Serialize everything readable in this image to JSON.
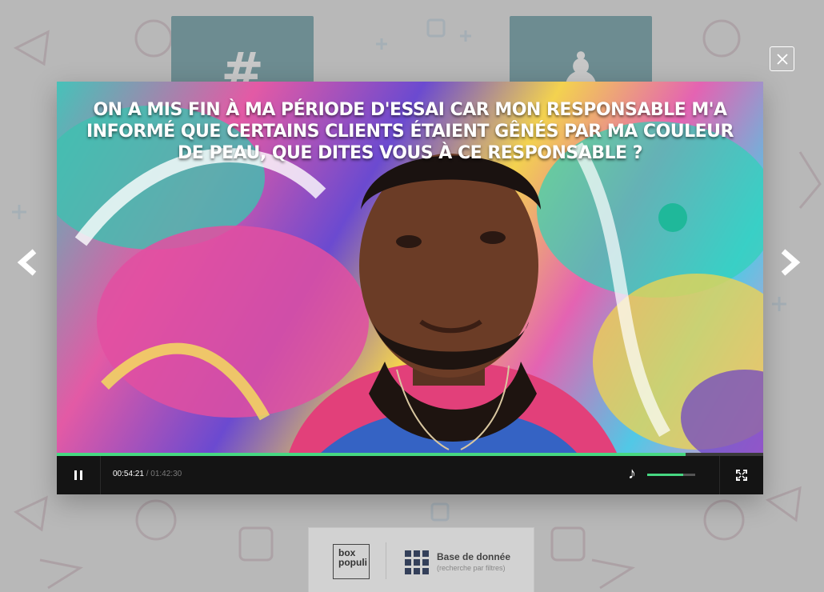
{
  "modal": {
    "caption": "On a mis fin à ma période d'essai car mon responsable m'a informé que certains clients étaient gênés par ma couleur de peau, que dites vous à ce responsable ?"
  },
  "player": {
    "current_time": "00:54:21",
    "separator": "/",
    "total_time": "01:42:30",
    "progress": 0.89,
    "volume": 0.75,
    "accent_color": "#47d782"
  },
  "background_cards": [
    {
      "icon": "hashtag-icon",
      "glyph": "#"
    },
    {
      "icon": "contact-icon",
      "glyph": "♟"
    }
  ],
  "footer": {
    "logo_line1": "box",
    "logo_line2": "populi",
    "db_title": "Base de donnée",
    "db_subtitle": "(recherche par filtres)"
  },
  "icons": {
    "close": "close-icon",
    "prev": "chevron-left-icon",
    "next": "chevron-right-icon",
    "pause": "pause-icon",
    "volume": "volume-icon",
    "fullscreen": "fullscreen-icon",
    "grid": "grid-icon"
  }
}
